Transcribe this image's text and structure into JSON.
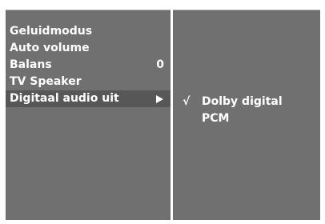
{
  "menu": {
    "items": [
      {
        "label": "Geluidmodus",
        "value": "",
        "selected": false
      },
      {
        "label": "Auto volume",
        "value": "",
        "selected": false
      },
      {
        "label": "Balans",
        "value": "0",
        "selected": false
      },
      {
        "label": "TV Speaker",
        "value": "",
        "selected": false
      },
      {
        "label": "Digitaal audio uit",
        "value": "",
        "selected": true,
        "icon": "arrow-right-icon"
      }
    ]
  },
  "submenu": {
    "check_mark": "√",
    "options": [
      {
        "label": "Dolby digital",
        "checked": true
      },
      {
        "label": "PCM",
        "checked": false
      }
    ]
  },
  "colors": {
    "panel": "#707070",
    "selected_row": "#575757",
    "text": "#ffffff",
    "background": "#ffffff"
  }
}
